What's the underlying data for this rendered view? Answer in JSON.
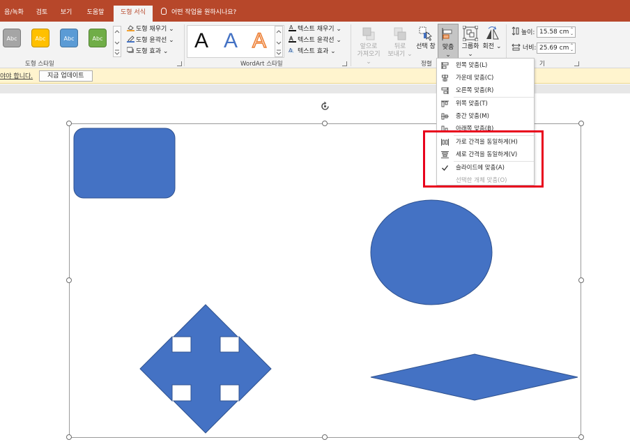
{
  "tabs": [
    {
      "id": "record",
      "label": "음/녹화"
    },
    {
      "id": "review",
      "label": "검토"
    },
    {
      "id": "view",
      "label": "보기"
    },
    {
      "id": "help",
      "label": "도움말"
    },
    {
      "id": "shape-format",
      "label": "도형 서식",
      "active": true
    }
  ],
  "tell_me": "어떤 작업을 원하시나요?",
  "ribbon": {
    "shape_styles": {
      "swatch_label": "Abc",
      "swatches": [
        "#a5a5a5",
        "#ffc000",
        "#5b9bd5",
        "#70ad47"
      ],
      "fill": "도형 채우기",
      "outline": "도형 윤곽선",
      "effects": "도형 효과",
      "group_label": "도형 스타일"
    },
    "wordart": {
      "sample": "A",
      "text_fill": "텍스트 채우기",
      "text_outline": "텍스트 윤곽선",
      "text_effects": "텍스트 효과",
      "group_label": "WordArt 스타일"
    },
    "arrange": {
      "bring_forward": [
        "앞으로",
        "가져오기"
      ],
      "send_backward": [
        "뒤로",
        "보내기"
      ],
      "selection_pane": "선택 창",
      "align": "맞춤",
      "group": "그룹화",
      "rotate": "회전",
      "group_label": "정렬"
    },
    "size": {
      "height_label": "높이:",
      "height_value": "15.58 cm",
      "width_label": "너비:",
      "width_value": "25.69 cm",
      "group_label_fragment": "기"
    }
  },
  "message_bar": {
    "text": "야야 합니다.",
    "button": "지금 업데이트"
  },
  "align_menu": {
    "items": [
      {
        "label": "왼쪽 맞춤(L)",
        "icon": "align-left-icon"
      },
      {
        "label": "가운데 맞춤(C)",
        "icon": "align-center-icon"
      },
      {
        "label": "오른쪽 맞춤(R)",
        "icon": "align-right-icon"
      },
      {
        "label": "위쪽 맞춤(T)",
        "icon": "align-top-icon"
      },
      {
        "label": "중간 맞춤(M)",
        "icon": "align-middle-icon"
      },
      {
        "label": "아래쪽 맞춤(B)",
        "icon": "align-bottom-icon"
      },
      {
        "label": "가로 간격을 동일하게(H)",
        "icon": "distribute-horizontal-icon"
      },
      {
        "label": "세로 간격을 동일하게(V)",
        "icon": "distribute-vertical-icon"
      },
      {
        "label": "슬라이드에 맞춤(A)",
        "icon": "checkmark-icon",
        "checked": true
      },
      {
        "label": "선택한 개체 맞춤(O)",
        "disabled": true
      }
    ]
  },
  "colors": {
    "accent": "#b7472a",
    "shape_fill": "#4472c4",
    "shape_outline": "#2f528f",
    "highlight": "#e8001c"
  }
}
